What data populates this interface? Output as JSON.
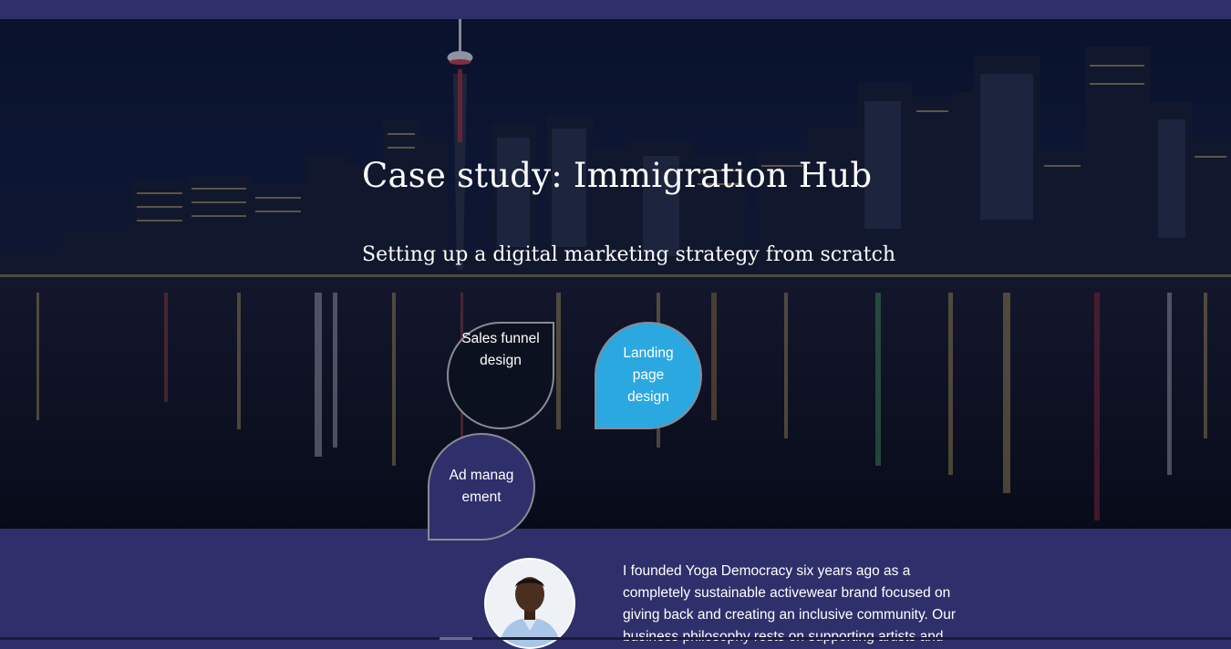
{
  "hero": {
    "title": "Case study: Immigration Hub",
    "subtitle": "Setting up a digital marketing strategy from scratch"
  },
  "services": [
    {
      "label": "Sales funnel design",
      "color": "#0c111f"
    },
    {
      "label": "Landing page design",
      "color": "#2ba8e0"
    },
    {
      "label": "Ad management",
      "color": "#2f2f6b"
    }
  ],
  "testimonial": {
    "text": "I founded Yoga Democracy six years ago as a completely sustainable activewear brand focused on giving back and creating an inclusive community. Our business philosophy rests on supporting artists and"
  },
  "colors": {
    "brand_navy": "#2f2f6b",
    "accent_blue": "#2ba8e0"
  }
}
